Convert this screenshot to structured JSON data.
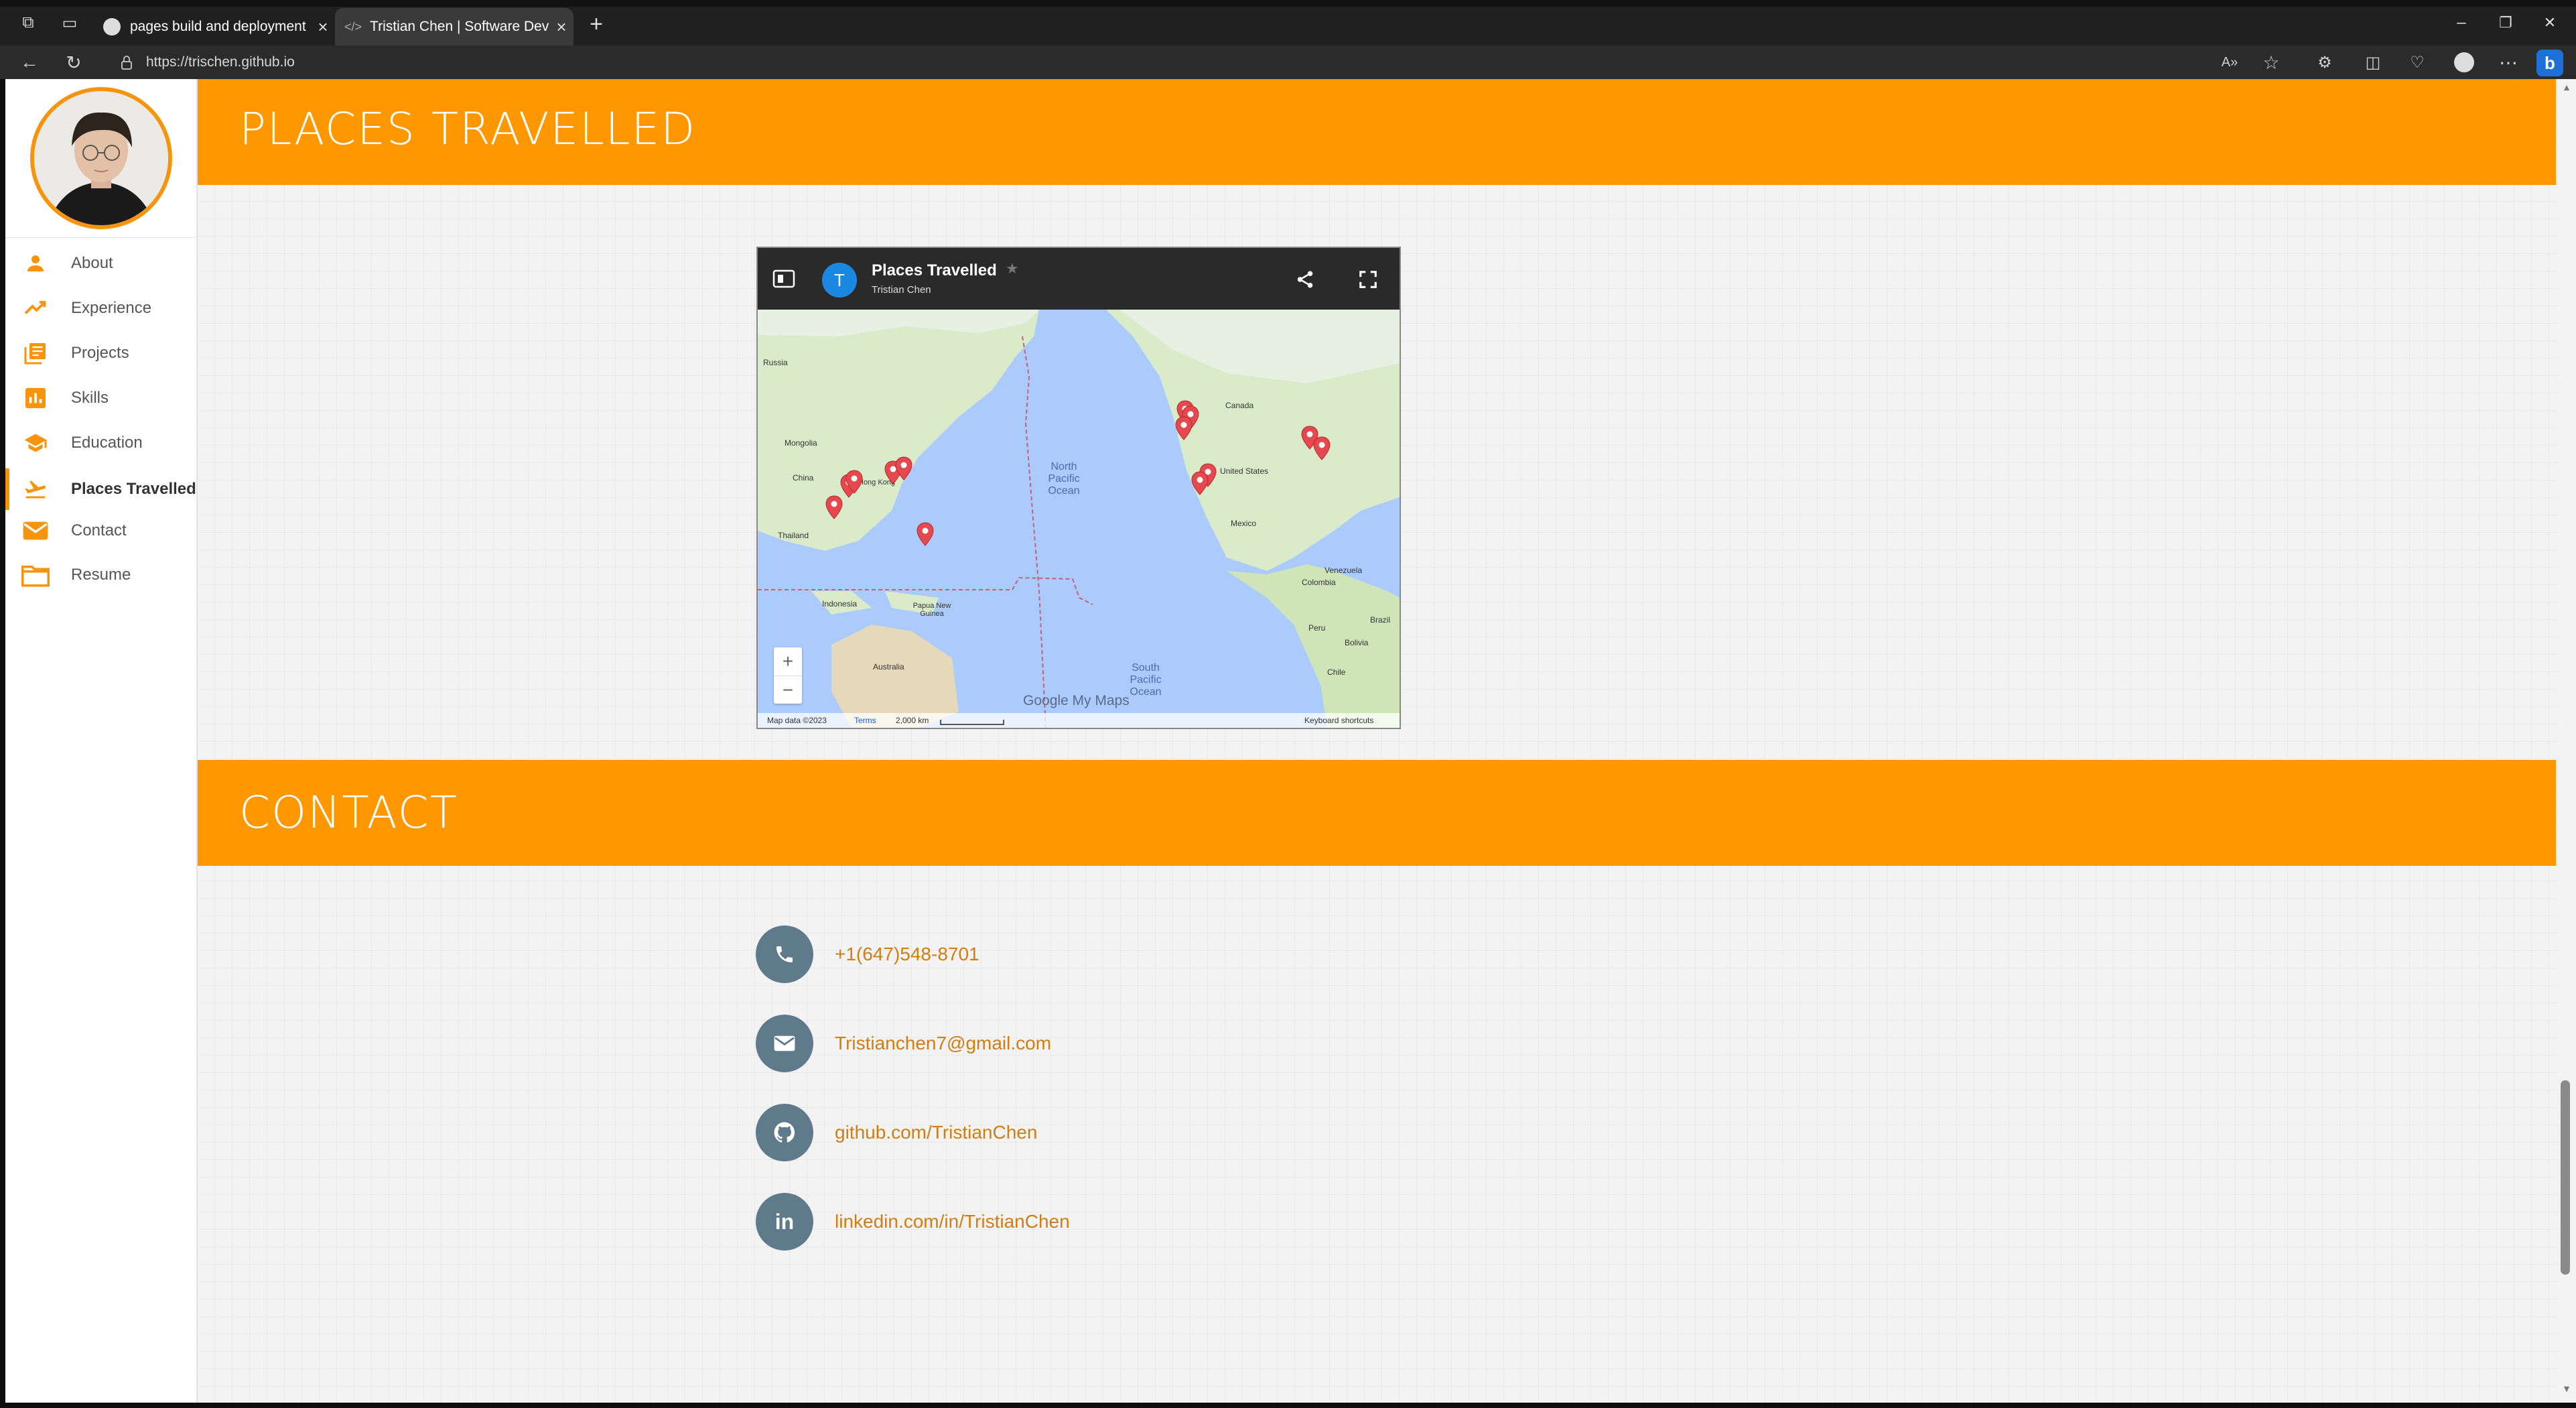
{
  "browser": {
    "tabs": [
      {
        "label": "pages build and deployment · Tr",
        "active": false
      },
      {
        "label": "Tristian Chen | Software Develop",
        "active": true
      }
    ],
    "new_tab": "+",
    "url": "https://trischen.github.io",
    "window_controls": [
      "–",
      "❐",
      "✕"
    ]
  },
  "sidebar": {
    "items": [
      {
        "label": "About",
        "icon": "person-icon"
      },
      {
        "label": "Experience",
        "icon": "trending-up-icon"
      },
      {
        "label": "Projects",
        "icon": "library-books-icon"
      },
      {
        "label": "Skills",
        "icon": "bar-chart-icon"
      },
      {
        "label": "Education",
        "icon": "school-icon"
      },
      {
        "label": "Places Travelled",
        "icon": "flight-takeoff-icon",
        "active": true
      },
      {
        "label": "Contact",
        "icon": "mail-icon"
      },
      {
        "label": "Resume",
        "icon": "folder-icon"
      }
    ]
  },
  "places": {
    "heading": "PLACES TRAVELLED",
    "map": {
      "title": "Places Travelled",
      "author": "Tristian Chen",
      "avatar_letter": "T",
      "labels": {
        "russia": "Russia",
        "mongolia": "Mongolia",
        "china": "China",
        "thailand": "Thailand",
        "indonesia": "Indonesia",
        "png": "Papua New Guinea",
        "australia": "Australia",
        "npo": "North Pacific Ocean",
        "spo": "South Pacific Ocean",
        "canada": "Canada",
        "us": "United States",
        "mexico": "Mexico",
        "venezuela": "Venezuela",
        "colombia": "Colombia",
        "peru": "Peru",
        "brazil": "Brazil",
        "bolivia": "Bolivia",
        "chile": "Chile",
        "hk": "Hong Kong"
      },
      "footer": {
        "map_data": "Map data ©2023",
        "terms": "Terms",
        "scale": "2,000 km",
        "shortcuts": "Keyboard shortcuts",
        "brand": "Google My Maps"
      },
      "zoom_in": "+",
      "zoom_out": "−"
    }
  },
  "contact": {
    "heading": "CONTACT",
    "items": [
      {
        "text": "+1(647)548-8701",
        "icon": "phone-icon"
      },
      {
        "text": "Tristianchen7@gmail.com",
        "icon": "mail-icon"
      },
      {
        "text": "github.com/TristianChen",
        "icon": "github-icon"
      },
      {
        "text": "linkedin.com/in/TristianChen",
        "icon": "linkedin-icon"
      }
    ]
  },
  "colors": {
    "accent": "#ff9800",
    "link": "#d27d12",
    "icon_circle": "#5f7a8b"
  }
}
